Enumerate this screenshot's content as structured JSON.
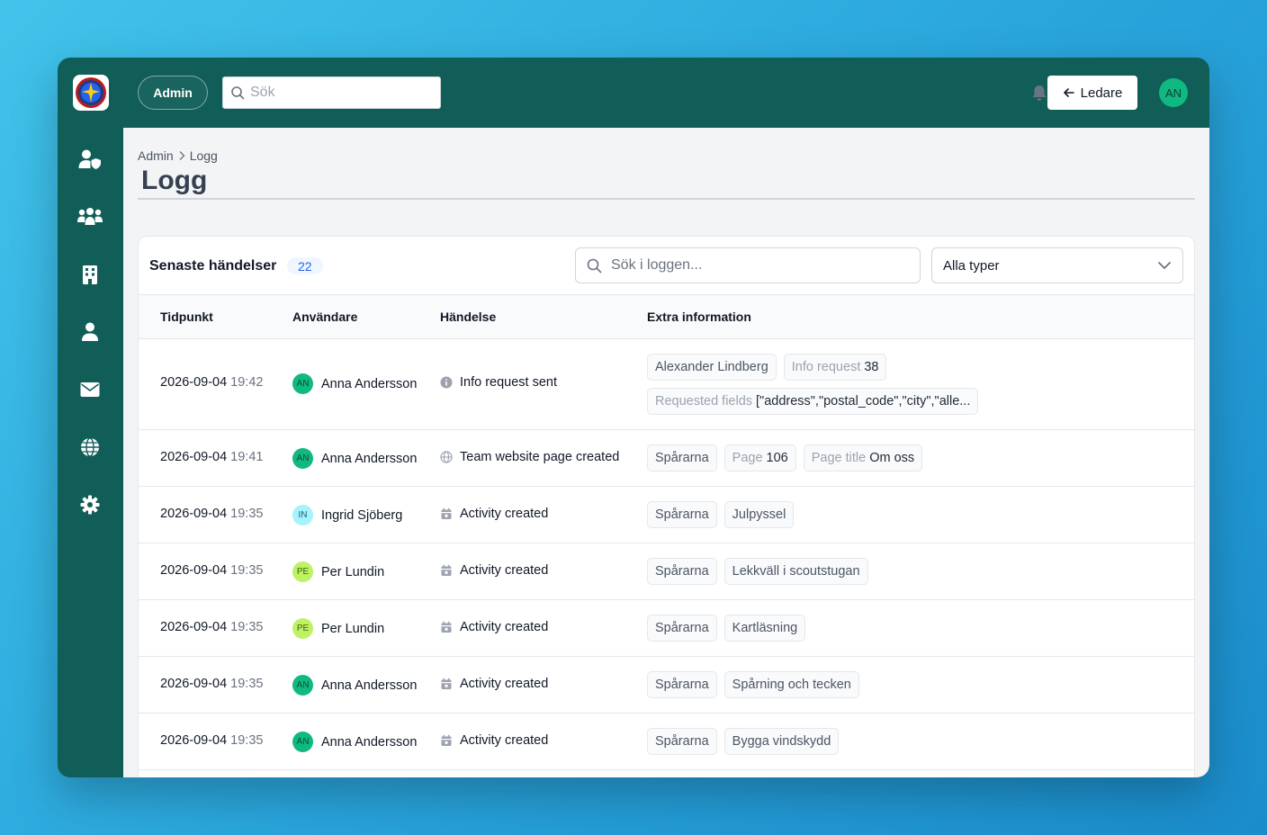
{
  "topbar": {
    "admin_label": "Admin",
    "search_placeholder": "Sök",
    "ledare_label": "Ledare",
    "user_initials": "AN"
  },
  "sidebar": {
    "items": [
      {
        "icon": "user-shield-icon"
      },
      {
        "icon": "users-group-icon"
      },
      {
        "icon": "building-icon"
      },
      {
        "icon": "user-icon"
      },
      {
        "icon": "envelope-icon"
      },
      {
        "icon": "globe-icon"
      },
      {
        "icon": "gear-icon"
      }
    ]
  },
  "breadcrumb": {
    "parent": "Admin",
    "current": "Logg"
  },
  "page": {
    "title": "Logg"
  },
  "log": {
    "title": "Senaste händelser",
    "count": "22",
    "search_placeholder": "Sök i loggen...",
    "type_filter": "Alla typer",
    "columns": {
      "time": "Tidpunkt",
      "user": "Användare",
      "event": "Händelse",
      "extra": "Extra information"
    },
    "rows": [
      {
        "date": "2026-09-04",
        "time": "19:42",
        "initials": "AN",
        "user": "Anna Andersson",
        "event_icon": "info-circle-icon",
        "event": "Info request sent",
        "chip1": "Alexander Lindberg",
        "chip2_key": "Info request",
        "chip2_val": "38",
        "chip3_key": "Requested fields",
        "chip3_val": "[\"address\",\"postal_code\",\"city\",\"alle..."
      },
      {
        "date": "2026-09-04",
        "time": "19:41",
        "initials": "AN",
        "user": "Anna Andersson",
        "event_icon": "globe-icon",
        "event": "Team website page created",
        "chip1": "Spårarna",
        "chip2_key": "Page",
        "chip2_val": "106",
        "chip3_key": "Page title",
        "chip3_val": "Om oss"
      },
      {
        "date": "2026-09-04",
        "time": "19:35",
        "initials": "IN",
        "user": "Ingrid Sjöberg",
        "event_icon": "calendar-icon",
        "event": "Activity created",
        "chip1": "Spårarna",
        "chip2": "Julpyssel"
      },
      {
        "date": "2026-09-04",
        "time": "19:35",
        "initials": "PE",
        "user": "Per Lundin",
        "event_icon": "calendar-icon",
        "event": "Activity created",
        "chip1": "Spårarna",
        "chip2": "Lekkväll i scoutstugan"
      },
      {
        "date": "2026-09-04",
        "time": "19:35",
        "initials": "PE",
        "user": "Per Lundin",
        "event_icon": "calendar-icon",
        "event": "Activity created",
        "chip1": "Spårarna",
        "chip2": "Kartläsning"
      },
      {
        "date": "2026-09-04",
        "time": "19:35",
        "initials": "AN",
        "user": "Anna Andersson",
        "event_icon": "calendar-icon",
        "event": "Activity created",
        "chip1": "Spårarna",
        "chip2": "Spårning och tecken"
      },
      {
        "date": "2026-09-04",
        "time": "19:35",
        "initials": "AN",
        "user": "Anna Andersson",
        "event_icon": "calendar-icon",
        "event": "Activity created",
        "chip1": "Spårarna",
        "chip2": "Bygga vindskydd"
      }
    ]
  },
  "colors": {
    "brand_dark": "#115e59",
    "avatar_an": "#10b981",
    "avatar_in": "#a5f3fc",
    "avatar_pe": "#bef264",
    "badge_blue": "#2563eb"
  }
}
